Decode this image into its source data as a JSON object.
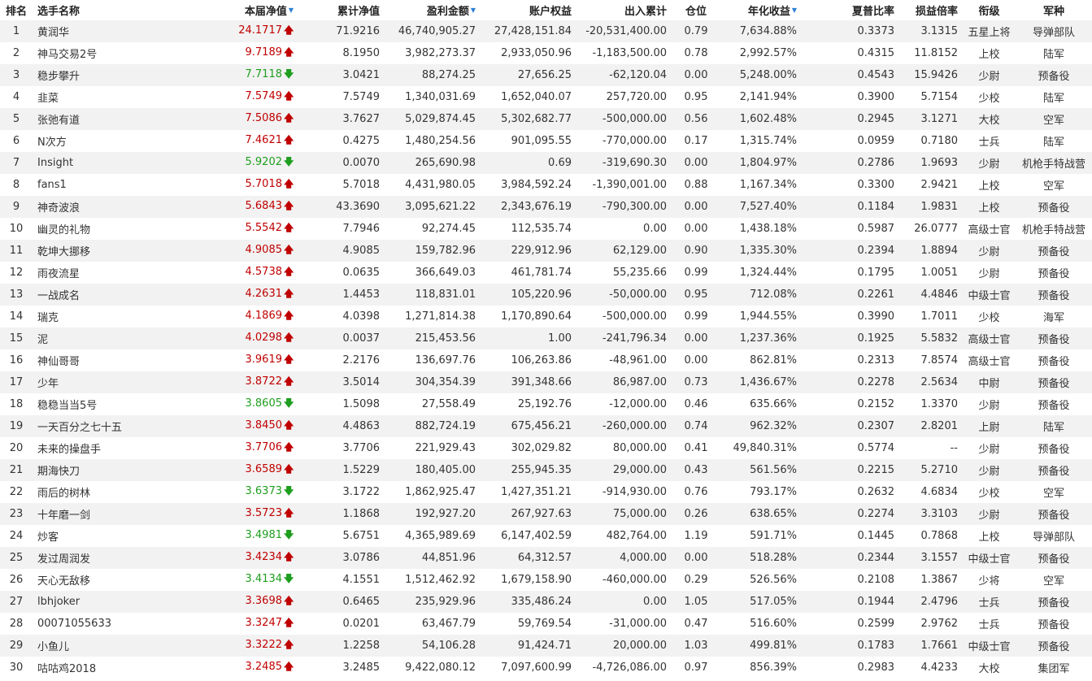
{
  "headers": [
    {
      "label": "排名",
      "sort": false
    },
    {
      "label": "选手名称",
      "sort": false
    },
    {
      "label": "本届净值",
      "sort": true
    },
    {
      "label": "累计净值",
      "sort": false
    },
    {
      "label": "盈利金额",
      "sort": true
    },
    {
      "label": "账户权益",
      "sort": false
    },
    {
      "label": "出入累计",
      "sort": false
    },
    {
      "label": "仓位",
      "sort": false
    },
    {
      "label": "年化收益",
      "sort": true
    },
    {
      "label": "夏普比率",
      "sort": false
    },
    {
      "label": "损益倍率",
      "sort": false
    },
    {
      "label": "衔级",
      "sort": false
    },
    {
      "label": "军种",
      "sort": false
    }
  ],
  "sort_icon": "▼",
  "arrows": {
    "up": "🡅",
    "down": "🡇"
  },
  "colors": {
    "up": "#c00000",
    "down": "#1e9e1e",
    "stripe": "#f2f2f2"
  },
  "rows": [
    {
      "rank": "1",
      "name": "黄润华",
      "nav": "24.1717",
      "dir": "up",
      "cum": "71.9216",
      "profit": "46,740,905.27",
      "equity": "27,428,151.84",
      "flow": "-20,531,400.00",
      "pos": "0.79",
      "annual": "7,634.88%",
      "sharpe": "0.3373",
      "pl": "3.1315",
      "grade": "五星上将",
      "branch": "导弹部队"
    },
    {
      "rank": "2",
      "name": "神马交易2号",
      "nav": "9.7189",
      "dir": "up",
      "cum": "8.1950",
      "profit": "3,982,273.37",
      "equity": "2,933,050.96",
      "flow": "-1,183,500.00",
      "pos": "0.78",
      "annual": "2,992.57%",
      "sharpe": "0.4315",
      "pl": "11.8152",
      "grade": "上校",
      "branch": "陆军"
    },
    {
      "rank": "3",
      "name": "稳步攀升",
      "nav": "7.7118",
      "dir": "down",
      "cum": "3.0421",
      "profit": "88,274.25",
      "equity": "27,656.25",
      "flow": "-62,120.04",
      "pos": "0.00",
      "annual": "5,248.00%",
      "sharpe": "0.4543",
      "pl": "15.9426",
      "grade": "少尉",
      "branch": "预备役"
    },
    {
      "rank": "4",
      "name": "韭菜",
      "nav": "7.5749",
      "dir": "up",
      "cum": "7.5749",
      "profit": "1,340,031.69",
      "equity": "1,652,040.07",
      "flow": "257,720.00",
      "pos": "0.95",
      "annual": "2,141.94%",
      "sharpe": "0.3900",
      "pl": "5.7154",
      "grade": "少校",
      "branch": "陆军"
    },
    {
      "rank": "5",
      "name": "张弛有道",
      "nav": "7.5086",
      "dir": "up",
      "cum": "3.7627",
      "profit": "5,029,874.45",
      "equity": "5,302,682.77",
      "flow": "-500,000.00",
      "pos": "0.56",
      "annual": "1,602.48%",
      "sharpe": "0.2945",
      "pl": "3.1271",
      "grade": "大校",
      "branch": "空军"
    },
    {
      "rank": "6",
      "name": "N次方",
      "nav": "7.4621",
      "dir": "up",
      "cum": "0.4275",
      "profit": "1,480,254.56",
      "equity": "901,095.55",
      "flow": "-770,000.00",
      "pos": "0.17",
      "annual": "1,315.74%",
      "sharpe": "0.0959",
      "pl": "0.7180",
      "grade": "士兵",
      "branch": "陆军"
    },
    {
      "rank": "7",
      "name": "Insight",
      "nav": "5.9202",
      "dir": "down",
      "cum": "0.0070",
      "profit": "265,690.98",
      "equity": "0.69",
      "flow": "-319,690.30",
      "pos": "0.00",
      "annual": "1,804.97%",
      "sharpe": "0.2786",
      "pl": "1.9693",
      "grade": "少尉",
      "branch": "机枪手特战营"
    },
    {
      "rank": "8",
      "name": "fans1",
      "nav": "5.7018",
      "dir": "up",
      "cum": "5.7018",
      "profit": "4,431,980.05",
      "equity": "3,984,592.24",
      "flow": "-1,390,001.00",
      "pos": "0.88",
      "annual": "1,167.34%",
      "sharpe": "0.3300",
      "pl": "2.9421",
      "grade": "上校",
      "branch": "空军"
    },
    {
      "rank": "9",
      "name": "神奇波浪",
      "nav": "5.6843",
      "dir": "up",
      "cum": "43.3690",
      "profit": "3,095,621.22",
      "equity": "2,343,676.19",
      "flow": "-790,300.00",
      "pos": "0.00",
      "annual": "7,527.40%",
      "sharpe": "0.1184",
      "pl": "1.9831",
      "grade": "上校",
      "branch": "预备役"
    },
    {
      "rank": "10",
      "name": "幽灵的礼物",
      "nav": "5.5542",
      "dir": "up",
      "cum": "7.7946",
      "profit": "92,274.45",
      "equity": "112,535.74",
      "flow": "0.00",
      "pos": "0.00",
      "annual": "1,438.18%",
      "sharpe": "0.5987",
      "pl": "26.0777",
      "grade": "高级士官",
      "branch": "机枪手特战营"
    },
    {
      "rank": "11",
      "name": "乾坤大挪移",
      "nav": "4.9085",
      "dir": "up",
      "cum": "4.9085",
      "profit": "159,782.96",
      "equity": "229,912.96",
      "flow": "62,129.00",
      "pos": "0.90",
      "annual": "1,335.30%",
      "sharpe": "0.2394",
      "pl": "1.8894",
      "grade": "少尉",
      "branch": "预备役"
    },
    {
      "rank": "12",
      "name": "雨夜流星",
      "nav": "4.5738",
      "dir": "up",
      "cum": "0.0635",
      "profit": "366,649.03",
      "equity": "461,781.74",
      "flow": "55,235.66",
      "pos": "0.99",
      "annual": "1,324.44%",
      "sharpe": "0.1795",
      "pl": "1.0051",
      "grade": "少尉",
      "branch": "预备役"
    },
    {
      "rank": "13",
      "name": "一战成名",
      "nav": "4.2631",
      "dir": "up",
      "cum": "1.4453",
      "profit": "118,831.01",
      "equity": "105,220.96",
      "flow": "-50,000.00",
      "pos": "0.95",
      "annual": "712.08%",
      "sharpe": "0.2261",
      "pl": "4.4846",
      "grade": "中级士官",
      "branch": "预备役"
    },
    {
      "rank": "14",
      "name": "瑞克",
      "nav": "4.1869",
      "dir": "up",
      "cum": "4.0398",
      "profit": "1,271,814.38",
      "equity": "1,170,890.64",
      "flow": "-500,000.00",
      "pos": "0.99",
      "annual": "1,944.55%",
      "sharpe": "0.3990",
      "pl": "1.7011",
      "grade": "少校",
      "branch": "海军"
    },
    {
      "rank": "15",
      "name": "泥",
      "nav": "4.0298",
      "dir": "up",
      "cum": "0.0037",
      "profit": "215,453.56",
      "equity": "1.00",
      "flow": "-241,796.34",
      "pos": "0.00",
      "annual": "1,237.36%",
      "sharpe": "0.1925",
      "pl": "5.5832",
      "grade": "高级士官",
      "branch": "预备役"
    },
    {
      "rank": "16",
      "name": "神仙哥哥",
      "nav": "3.9619",
      "dir": "up",
      "cum": "2.2176",
      "profit": "136,697.76",
      "equity": "106,263.86",
      "flow": "-48,961.00",
      "pos": "0.00",
      "annual": "862.81%",
      "sharpe": "0.2313",
      "pl": "7.8574",
      "grade": "高级士官",
      "branch": "预备役"
    },
    {
      "rank": "17",
      "name": "少年",
      "nav": "3.8722",
      "dir": "up",
      "cum": "3.5014",
      "profit": "304,354.39",
      "equity": "391,348.66",
      "flow": "86,987.00",
      "pos": "0.73",
      "annual": "1,436.67%",
      "sharpe": "0.2278",
      "pl": "2.5634",
      "grade": "中尉",
      "branch": "预备役"
    },
    {
      "rank": "18",
      "name": "稳稳当当5号",
      "nav": "3.8605",
      "dir": "down",
      "cum": "1.5098",
      "profit": "27,558.49",
      "equity": "25,192.76",
      "flow": "-12,000.00",
      "pos": "0.46",
      "annual": "635.66%",
      "sharpe": "0.2152",
      "pl": "1.3370",
      "grade": "少尉",
      "branch": "预备役"
    },
    {
      "rank": "19",
      "name": "一天百分之七十五",
      "nav": "3.8450",
      "dir": "up",
      "cum": "4.4863",
      "profit": "882,724.19",
      "equity": "675,456.21",
      "flow": "-260,000.00",
      "pos": "0.74",
      "annual": "962.32%",
      "sharpe": "0.2307",
      "pl": "2.8201",
      "grade": "上尉",
      "branch": "陆军"
    },
    {
      "rank": "20",
      "name": "未来的操盘手",
      "nav": "3.7706",
      "dir": "up",
      "cum": "3.7706",
      "profit": "221,929.43",
      "equity": "302,029.82",
      "flow": "80,000.00",
      "pos": "0.41",
      "annual": "49,840.31%",
      "sharpe": "0.5774",
      "pl": "--",
      "grade": "少尉",
      "branch": "预备役"
    },
    {
      "rank": "21",
      "name": "期海快刀",
      "nav": "3.6589",
      "dir": "up",
      "cum": "1.5229",
      "profit": "180,405.00",
      "equity": "255,945.35",
      "flow": "29,000.00",
      "pos": "0.43",
      "annual": "561.56%",
      "sharpe": "0.2215",
      "pl": "5.2710",
      "grade": "少尉",
      "branch": "预备役"
    },
    {
      "rank": "22",
      "name": "雨后的树林",
      "nav": "3.6373",
      "dir": "down",
      "cum": "3.1722",
      "profit": "1,862,925.47",
      "equity": "1,427,351.21",
      "flow": "-914,930.00",
      "pos": "0.76",
      "annual": "793.17%",
      "sharpe": "0.2632",
      "pl": "4.6834",
      "grade": "少校",
      "branch": "空军"
    },
    {
      "rank": "23",
      "name": "十年磨一剑",
      "nav": "3.5723",
      "dir": "up",
      "cum": "1.1868",
      "profit": "192,927.20",
      "equity": "267,927.63",
      "flow": "75,000.00",
      "pos": "0.26",
      "annual": "638.65%",
      "sharpe": "0.2274",
      "pl": "3.3103",
      "grade": "少尉",
      "branch": "预备役"
    },
    {
      "rank": "24",
      "name": "炒客",
      "nav": "3.4981",
      "dir": "down",
      "cum": "5.6751",
      "profit": "4,365,989.69",
      "equity": "6,147,402.59",
      "flow": "482,764.00",
      "pos": "1.19",
      "annual": "591.71%",
      "sharpe": "0.1445",
      "pl": "0.7868",
      "grade": "上校",
      "branch": "导弹部队"
    },
    {
      "rank": "25",
      "name": "发过周润发",
      "nav": "3.4234",
      "dir": "up",
      "cum": "3.0786",
      "profit": "44,851.96",
      "equity": "64,312.57",
      "flow": "4,000.00",
      "pos": "0.00",
      "annual": "518.28%",
      "sharpe": "0.2344",
      "pl": "3.1557",
      "grade": "中级士官",
      "branch": "预备役"
    },
    {
      "rank": "26",
      "name": "天心无敌移",
      "nav": "3.4134",
      "dir": "down",
      "cum": "4.1551",
      "profit": "1,512,462.92",
      "equity": "1,679,158.90",
      "flow": "-460,000.00",
      "pos": "0.29",
      "annual": "526.56%",
      "sharpe": "0.2108",
      "pl": "1.3867",
      "grade": "少将",
      "branch": "空军"
    },
    {
      "rank": "27",
      "name": "lbhjoker",
      "nav": "3.3698",
      "dir": "up",
      "cum": "0.6465",
      "profit": "235,929.96",
      "equity": "335,486.24",
      "flow": "0.00",
      "pos": "1.05",
      "annual": "517.05%",
      "sharpe": "0.1944",
      "pl": "2.4796",
      "grade": "士兵",
      "branch": "预备役"
    },
    {
      "rank": "28",
      "name": "00071055633",
      "nav": "3.3247",
      "dir": "up",
      "cum": "0.0201",
      "profit": "63,467.79",
      "equity": "59,769.54",
      "flow": "-31,000.00",
      "pos": "0.47",
      "annual": "516.60%",
      "sharpe": "0.2599",
      "pl": "2.9762",
      "grade": "士兵",
      "branch": "预备役"
    },
    {
      "rank": "29",
      "name": "小鱼儿",
      "nav": "3.3222",
      "dir": "up",
      "cum": "1.2258",
      "profit": "54,106.28",
      "equity": "91,424.71",
      "flow": "20,000.00",
      "pos": "1.03",
      "annual": "499.81%",
      "sharpe": "0.1783",
      "pl": "1.7661",
      "grade": "中级士官",
      "branch": "预备役"
    },
    {
      "rank": "30",
      "name": "咕咕鸡2018",
      "nav": "3.2485",
      "dir": "up",
      "cum": "3.2485",
      "profit": "9,422,080.12",
      "equity": "7,097,600.99",
      "flow": "-4,726,086.00",
      "pos": "0.97",
      "annual": "856.39%",
      "sharpe": "0.2983",
      "pl": "4.4233",
      "grade": "大校",
      "branch": "集团军"
    }
  ]
}
